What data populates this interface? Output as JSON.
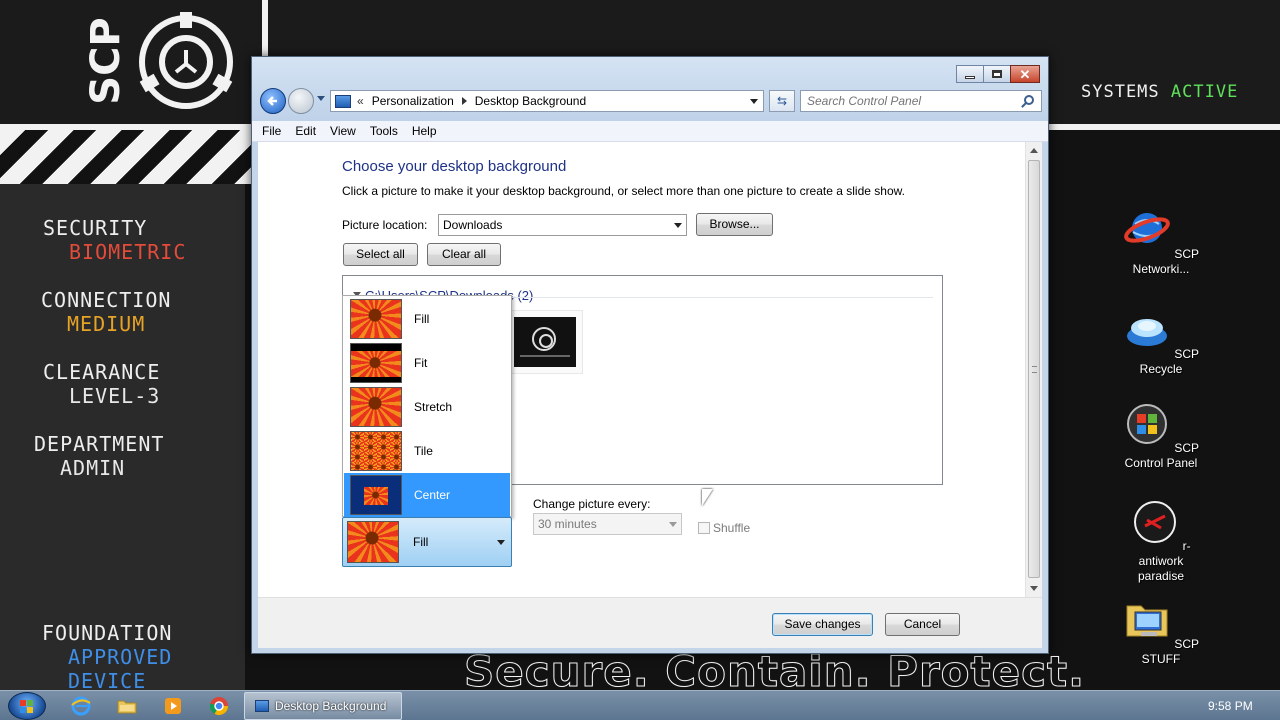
{
  "wallpaper": {
    "scp_text": "SCP",
    "systems_label": "SYSTEMS",
    "systems_value": "ACTIVE",
    "status": [
      {
        "label": "SECURITY",
        "value": "BIOMETRIC",
        "color": "#e34b3b"
      },
      {
        "label": "CONNECTION",
        "value": "MEDIUM",
        "color": "#e6a326"
      },
      {
        "label": "CLEARANCE",
        "value": "LEVEL-3",
        "color": "#e8e8e8"
      },
      {
        "label": "DEPARTMENT",
        "value": "ADMIN",
        "color": "#e8e8e8"
      },
      {
        "label": "FOUNDATION",
        "value": "APPROVED",
        "value2": "DEVICE",
        "color": "#3f8ee8"
      }
    ],
    "slogan": "Secure. Contain. Protect."
  },
  "desktop_icons": [
    {
      "label": "SCP Networki...",
      "icon": "network-globe-icon"
    },
    {
      "label": "SCP Recycle",
      "icon": "recycle-bin-icon"
    },
    {
      "label": "SCP Control Panel",
      "icon": "control-panel-icon"
    },
    {
      "label": "r-antiwork paradise",
      "icon": "reddit-shortcut-icon"
    },
    {
      "label": "SCP STUFF",
      "icon": "folder-computer-icon"
    }
  ],
  "window": {
    "breadcrumb_sep": "«",
    "breadcrumb": [
      "Personalization",
      "Desktop Background"
    ],
    "search_placeholder": "Search Control Panel",
    "menu": [
      "File",
      "Edit",
      "View",
      "Tools",
      "Help"
    ],
    "heading": "Choose your desktop background",
    "description": "Click a picture to make it your desktop background, or select more than one picture to create a slide show.",
    "picture_location_label": "Picture location:",
    "picture_location_value": "Downloads",
    "browse_label": "Browse...",
    "select_all_label": "Select all",
    "clear_all_label": "Clear all",
    "folder_group_label": "C:\\Users\\SCP\\Downloads (2)",
    "picture_position": {
      "selected": "Fill",
      "options": [
        "Fill",
        "Fit",
        "Stretch",
        "Tile",
        "Center"
      ],
      "highlighted": "Center"
    },
    "change_picture_label": "Change picture every:",
    "change_picture_value": "30 minutes",
    "shuffle_label": "Shuffle",
    "save_label": "Save changes",
    "cancel_label": "Cancel",
    "close_glyph": "✕"
  },
  "taskbar": {
    "task_label": "Desktop Background",
    "clock": "9:58 PM",
    "pinned": [
      "internet-explorer-icon",
      "explorer-folder-icon",
      "media-player-icon",
      "chrome-icon"
    ],
    "tray": [
      "search-tray-icon",
      "network-tray-icon",
      "display-tray-icon",
      "volume-tray-icon"
    ]
  }
}
